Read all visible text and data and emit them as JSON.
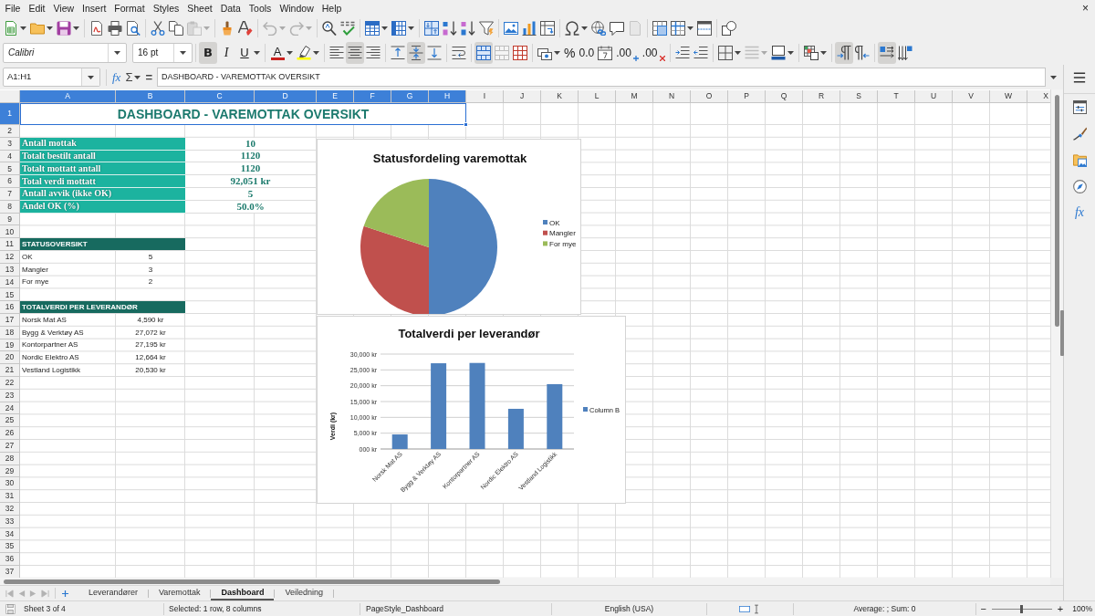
{
  "menu_bar": {
    "items": [
      "File",
      "Edit",
      "View",
      "Insert",
      "Format",
      "Styles",
      "Sheet",
      "Data",
      "Tools",
      "Window",
      "Help"
    ],
    "close": "×"
  },
  "standard_toolbar": {
    "paste": {
      "disabled": true
    },
    "undo": {
      "disabled": true
    },
    "redo": {
      "disabled": true
    },
    "headers_footers": {
      "disabled": true
    }
  },
  "formatting_toolbar": {
    "font_name": "Calibri",
    "font_size": "16 pt",
    "bold": {
      "label": "B",
      "on": true
    },
    "italic": {
      "label": "I",
      "on": false
    },
    "underline": {
      "label": "U",
      "on": false
    },
    "font_color": {
      "label": "A"
    },
    "align_left": {
      "on": false
    },
    "align_center": {
      "on": true
    },
    "align_right": {
      "on": false
    },
    "align_top": {
      "on": false
    },
    "align_middle": {
      "on": true
    },
    "align_bottom": {
      "on": false
    },
    "wrap_text": {
      "on": false
    },
    "merge_and_center": {
      "on": true
    },
    "merge_cells": {
      "disabled": true
    },
    "percent": {
      "label": "%"
    },
    "standard_format": {
      "label": "0.0"
    },
    "add_decimal": {
      "label": ".00"
    },
    "delete_decimal": {
      "label": ".00"
    },
    "border_style": {
      "disabled": true
    },
    "left_to_right": {
      "on": true
    },
    "right_to_left": {
      "on": false
    },
    "text_horizontal": {
      "on": true
    },
    "text_vertical": {
      "on": false
    }
  },
  "formula_bar": {
    "name_box": "A1:H1",
    "function_wizard": "fx",
    "sum": "Σ",
    "equals": "=",
    "content": "DASHBOARD - VAREMOTTAK OVERSIKT"
  },
  "sheet": {
    "columns": [
      {
        "label": "A",
        "selected": true
      },
      {
        "label": "B",
        "selected": true
      },
      {
        "label": "C",
        "selected": true
      },
      {
        "label": "D",
        "selected": true
      },
      {
        "label": "E",
        "selected": true
      },
      {
        "label": "F",
        "selected": true
      },
      {
        "label": "G",
        "selected": true
      },
      {
        "label": "H",
        "selected": true
      },
      {
        "label": "I",
        "selected": false
      },
      {
        "label": "J",
        "selected": false
      },
      {
        "label": "K",
        "selected": false
      },
      {
        "label": "L",
        "selected": false
      },
      {
        "label": "M",
        "selected": false
      },
      {
        "label": "N",
        "selected": false
      },
      {
        "label": "O",
        "selected": false
      },
      {
        "label": "P",
        "selected": false
      },
      {
        "label": "Q",
        "selected": false
      },
      {
        "label": "R",
        "selected": false
      },
      {
        "label": "S",
        "selected": false
      },
      {
        "label": "T",
        "selected": false
      },
      {
        "label": "U",
        "selected": false
      },
      {
        "label": "V",
        "selected": false
      },
      {
        "label": "W",
        "selected": false
      },
      {
        "label": "X",
        "selected": false
      }
    ],
    "rows": [
      {
        "label": "1",
        "selected": true,
        "kind": "title",
        "A": "DASHBOARD - VAREMOTTAK OVERSIKT"
      },
      {
        "label": "2",
        "selected": false
      },
      {
        "label": "3",
        "selected": false,
        "kind": "kpi",
        "A": "Antall mottak",
        "C": "10"
      },
      {
        "label": "4",
        "selected": false,
        "kind": "kpi",
        "A": "Totalt bestilt antall",
        "C": "1120"
      },
      {
        "label": "5",
        "selected": false,
        "kind": "kpi",
        "A": "Totalt mottatt antall",
        "C": "1120"
      },
      {
        "label": "6",
        "selected": false,
        "kind": "kpi",
        "A": "Total verdi mottatt",
        "C": "92,051 kr"
      },
      {
        "label": "7",
        "selected": false,
        "kind": "kpi",
        "A": "Antall avvik (ikke OK)",
        "C": "5"
      },
      {
        "label": "8",
        "selected": false,
        "kind": "kpi",
        "A": "Andel OK (%)",
        "C": "50.0%"
      },
      {
        "label": "9",
        "selected": false
      },
      {
        "label": "10",
        "selected": false
      },
      {
        "label": "11",
        "selected": false,
        "kind": "section",
        "A": "STATUSOVERSIKT"
      },
      {
        "label": "12",
        "selected": false,
        "kind": "entry",
        "A": "OK",
        "B": "5"
      },
      {
        "label": "13",
        "selected": false,
        "kind": "entry",
        "A": "Mangler",
        "B": "3"
      },
      {
        "label": "14",
        "selected": false,
        "kind": "entry",
        "A": "For mye",
        "B": "2"
      },
      {
        "label": "15",
        "selected": false
      },
      {
        "label": "16",
        "selected": false,
        "kind": "section",
        "A": "TOTALVERDI PER LEVERANDØR"
      },
      {
        "label": "17",
        "selected": false,
        "kind": "entry",
        "A": "Norsk Mat AS",
        "B": "4,590 kr"
      },
      {
        "label": "18",
        "selected": false,
        "kind": "entry",
        "A": "Bygg & Verktøy AS",
        "B": "27,072 kr"
      },
      {
        "label": "19",
        "selected": false,
        "kind": "entry",
        "A": "Kontorpartner AS",
        "B": "27,195 kr"
      },
      {
        "label": "20",
        "selected": false,
        "kind": "entry",
        "A": "Nordic Elektro AS",
        "B": "12,664 kr"
      },
      {
        "label": "21",
        "selected": false,
        "kind": "entry",
        "A": "Vestland Logistikk",
        "B": "20,530 kr"
      },
      {
        "label": "22",
        "selected": false
      },
      {
        "label": "23",
        "selected": false
      },
      {
        "label": "24",
        "selected": false
      },
      {
        "label": "25",
        "selected": false
      },
      {
        "label": "26",
        "selected": false
      },
      {
        "label": "27",
        "selected": false
      },
      {
        "label": "28",
        "selected": false
      },
      {
        "label": "29",
        "selected": false
      },
      {
        "label": "30",
        "selected": false
      },
      {
        "label": "31",
        "selected": false
      },
      {
        "label": "32",
        "selected": false
      },
      {
        "label": "33",
        "selected": false
      },
      {
        "label": "34",
        "selected": false
      },
      {
        "label": "35",
        "selected": false
      },
      {
        "label": "36",
        "selected": false
      },
      {
        "label": "37",
        "selected": false
      }
    ]
  },
  "charts": [
    {
      "chart_data": {
        "type": "pie",
        "title": "Statusfordeling varemottak",
        "categories": [
          "OK",
          "Mangler",
          "For mye"
        ],
        "values": [
          50,
          30,
          20
        ],
        "colors": [
          "#4f81bd",
          "#c0504d",
          "#9bbb59"
        ],
        "legend": "right"
      }
    },
    {
      "chart_data": {
        "type": "bar",
        "title": "Totalverdi per leverandør",
        "ylabel": "Verdi (kr)",
        "categories": [
          "Norsk Mat AS",
          "Bygg & Verktøy AS",
          "Kontorpartner AS",
          "Nordic Elektro AS",
          "Vestland Logistikk"
        ],
        "series": [
          {
            "name": "Column B",
            "color": "#4f81bd",
            "values": [
              4600,
              27100,
              27200,
              12700,
              20500
            ]
          }
        ],
        "ylim": [
          0,
          30000
        ],
        "yticks": [
          {
            "value": 0,
            "label": "000 kr"
          },
          {
            "value": 5000,
            "label": "5,000 kr"
          },
          {
            "value": 10000,
            "label": "10,000 kr"
          },
          {
            "value": 15000,
            "label": "15,000 kr"
          },
          {
            "value": 20000,
            "label": "20,000 kr"
          },
          {
            "value": 25000,
            "label": "25,000 kr"
          },
          {
            "value": 30000,
            "label": "30,000 kr"
          }
        ],
        "grid": true,
        "legend": "right"
      }
    }
  ],
  "sheet_tabs": {
    "navigation": {
      "disabled": true
    },
    "tabs": [
      {
        "label": "Leverandører",
        "selected": false
      },
      {
        "label": "Varemottak",
        "selected": false
      },
      {
        "label": "Dashboard",
        "selected": true
      },
      {
        "label": "Veiledning",
        "selected": false
      }
    ]
  },
  "sidebar": {
    "functions": "fx"
  },
  "status_bar": {
    "sheet": "Sheet 3 of 4",
    "selection": "Selected: 1 row, 8 columns",
    "page_style": "PageStyle_Dashboard",
    "language": "English (USA)",
    "summary": "Average: ; Sum: 0",
    "zoom_out": "−",
    "zoom_in": "+",
    "zoom": {
      "label": "100%",
      "level": 0.5
    }
  }
}
